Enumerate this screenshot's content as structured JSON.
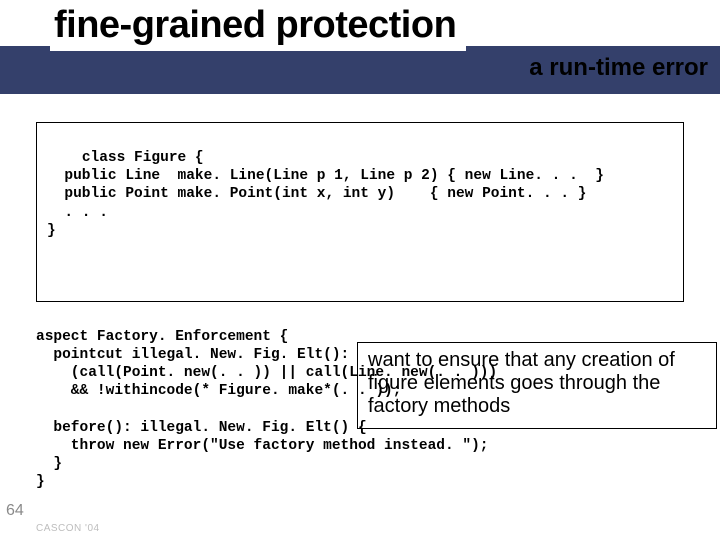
{
  "title": "fine-grained protection",
  "subtitle": "a run-time error",
  "code1": "class Figure {\n  public Line  make. Line(Line p 1, Line p 2) { new Line. . .  }\n  public Point make. Point(int x, int y)    { new Point. . . }\n  . . .\n}",
  "note": "want to ensure that any creation of figure elements goes through the factory methods",
  "code2": "aspect Factory. Enforcement {\n  pointcut illegal. New. Fig. Elt():\n    (call(Point. new(. . )) || call(Line. new(. . )))\n    && !withincode(* Figure. make*(. . ));\n\n  before(): illegal. New. Fig. Elt() {\n    throw new Error(\"Use factory method instead. \");\n  }\n}",
  "page_number": "64",
  "footer": "CASCON '04"
}
